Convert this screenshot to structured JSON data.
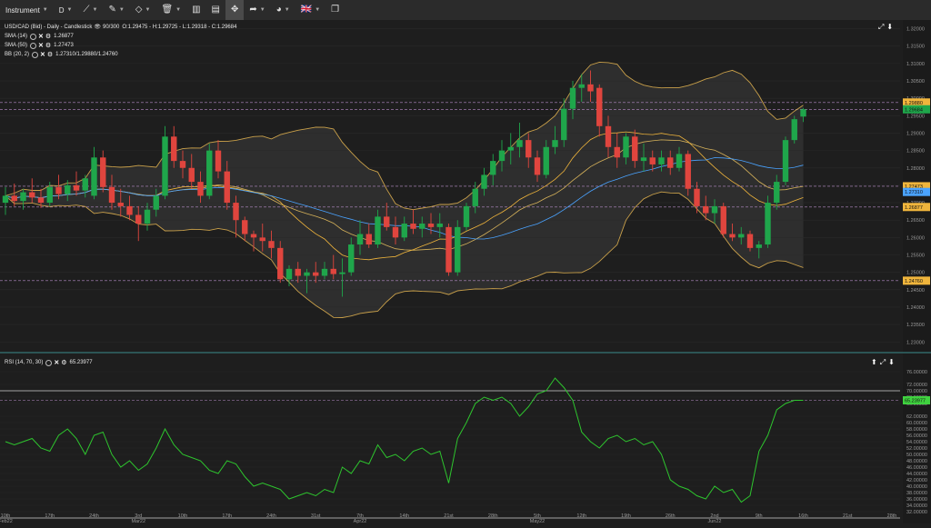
{
  "toolbar": {
    "instrument_label": "Instrument",
    "timeframe_label": "D",
    "flag_label": "🇬🇧"
  },
  "price_panel": {
    "info_line": "USD/CAD (Bid) - Daily - Candlestick",
    "bars_info": "90/300",
    "ohlc": "O:1.29475 - H:1.29725 - L:1.29318 - C:1.29684",
    "sma14_label": "SMA (14)",
    "sma14_value": "1.26877",
    "sma50_label": "SMA (50)",
    "sma50_value": "1.27473",
    "bb_label": "BB (20, 2)",
    "bb_value": "1.27310/1.29880/1.24760",
    "y_ticks": [
      "1.32000",
      "1.31500",
      "1.31000",
      "1.30500",
      "1.30000",
      "1.29500",
      "1.29000",
      "1.28500",
      "1.28000",
      "1.27500",
      "1.27000",
      "1.26500",
      "1.26000",
      "1.25500",
      "1.25000",
      "1.24500",
      "1.24000",
      "1.23500",
      "1.23000"
    ],
    "price_tags": [
      {
        "label": "1.29880",
        "color": "#f0b53c",
        "value": 1.2988
      },
      {
        "label": "1.29684",
        "color": "#1fa64b",
        "value": 1.29684
      },
      {
        "label": "1.27473",
        "color": "#f0b53c",
        "value": 1.27473
      },
      {
        "label": "1.27310",
        "color": "#4aa3ff",
        "value": 1.2731
      },
      {
        "label": "1.26877",
        "color": "#f0b53c",
        "value": 1.26877
      },
      {
        "label": "1.24760",
        "color": "#f0b53c",
        "value": 1.2476
      }
    ]
  },
  "rsi_panel": {
    "label": "RSI (14, 70, 30)",
    "value": "65.23977",
    "y_ticks": [
      "76.00000",
      "72.00000",
      "70.00000",
      "68.00000",
      "66.00000",
      "62.00000",
      "60.00000",
      "58.00000",
      "56.00000",
      "54.00000",
      "52.00000",
      "50.00000",
      "48.00000",
      "46.00000",
      "44.00000",
      "42.00000",
      "40.00000",
      "38.00000",
      "36.00000",
      "34.00000",
      "32.00000"
    ],
    "tag": {
      "label": "65.23977",
      "color": "#3fd23f"
    }
  },
  "x_axis": {
    "labels": [
      {
        "text": "10th",
        "sub": "Feb22",
        "i": 0
      },
      {
        "text": "17th",
        "sub": "",
        "i": 5
      },
      {
        "text": "24th",
        "sub": "",
        "i": 10
      },
      {
        "text": "3rd",
        "sub": "Mar22",
        "i": 15
      },
      {
        "text": "10th",
        "sub": "",
        "i": 20
      },
      {
        "text": "17th",
        "sub": "",
        "i": 25
      },
      {
        "text": "24th",
        "sub": "",
        "i": 30
      },
      {
        "text": "31st",
        "sub": "",
        "i": 35
      },
      {
        "text": "7th",
        "sub": "Apr22",
        "i": 40
      },
      {
        "text": "14th",
        "sub": "",
        "i": 45
      },
      {
        "text": "21st",
        "sub": "",
        "i": 50
      },
      {
        "text": "28th",
        "sub": "",
        "i": 55
      },
      {
        "text": "5th",
        "sub": "May22",
        "i": 60
      },
      {
        "text": "12th",
        "sub": "",
        "i": 65
      },
      {
        "text": "19th",
        "sub": "",
        "i": 70
      },
      {
        "text": "26th",
        "sub": "",
        "i": 75
      },
      {
        "text": "2nd",
        "sub": "Jun22",
        "i": 80
      },
      {
        "text": "9th",
        "sub": "",
        "i": 85
      },
      {
        "text": "16th",
        "sub": "",
        "i": 90
      },
      {
        "text": "21st",
        "sub": "",
        "i": 95
      },
      {
        "text": "28th",
        "sub": "",
        "i": 100
      }
    ]
  },
  "chart_data": [
    {
      "type": "candlestick",
      "title": "USD/CAD (Bid) - Daily - Candlestick",
      "ylim": [
        1.2285,
        1.3225
      ],
      "bb_upper_value": 1.2988,
      "bb_lower_value": 1.2476,
      "sma50_value": 1.27473,
      "close_value": 1.29684,
      "candles": [
        {
          "o": 1.27,
          "h": 1.2745,
          "l": 1.2665,
          "c": 1.272
        },
        {
          "o": 1.272,
          "h": 1.2755,
          "l": 1.269,
          "c": 1.2705
        },
        {
          "o": 1.2705,
          "h": 1.274,
          "l": 1.268,
          "c": 1.273
        },
        {
          "o": 1.273,
          "h": 1.277,
          "l": 1.27,
          "c": 1.2715
        },
        {
          "o": 1.2715,
          "h": 1.274,
          "l": 1.2685,
          "c": 1.27
        },
        {
          "o": 1.27,
          "h": 1.276,
          "l": 1.269,
          "c": 1.2745
        },
        {
          "o": 1.2745,
          "h": 1.278,
          "l": 1.271,
          "c": 1.2725
        },
        {
          "o": 1.2725,
          "h": 1.2765,
          "l": 1.2705,
          "c": 1.275
        },
        {
          "o": 1.275,
          "h": 1.279,
          "l": 1.272,
          "c": 1.2735
        },
        {
          "o": 1.2735,
          "h": 1.278,
          "l": 1.2715,
          "c": 1.277
        },
        {
          "o": 1.272,
          "h": 1.286,
          "l": 1.271,
          "c": 1.283
        },
        {
          "o": 1.283,
          "h": 1.285,
          "l": 1.273,
          "c": 1.2745
        },
        {
          "o": 1.2745,
          "h": 1.278,
          "l": 1.268,
          "c": 1.27
        },
        {
          "o": 1.27,
          "h": 1.274,
          "l": 1.266,
          "c": 1.269
        },
        {
          "o": 1.269,
          "h": 1.272,
          "l": 1.265,
          "c": 1.2665
        },
        {
          "o": 1.2665,
          "h": 1.269,
          "l": 1.259,
          "c": 1.264
        },
        {
          "o": 1.264,
          "h": 1.27,
          "l": 1.262,
          "c": 1.268
        },
        {
          "o": 1.268,
          "h": 1.274,
          "l": 1.266,
          "c": 1.272
        },
        {
          "o": 1.272,
          "h": 1.292,
          "l": 1.271,
          "c": 1.289
        },
        {
          "o": 1.289,
          "h": 1.292,
          "l": 1.28,
          "c": 1.282
        },
        {
          "o": 1.282,
          "h": 1.285,
          "l": 1.277,
          "c": 1.28
        },
        {
          "o": 1.28,
          "h": 1.284,
          "l": 1.274,
          "c": 1.276
        },
        {
          "o": 1.276,
          "h": 1.279,
          "l": 1.27,
          "c": 1.272
        },
        {
          "o": 1.272,
          "h": 1.287,
          "l": 1.271,
          "c": 1.285
        },
        {
          "o": 1.285,
          "h": 1.288,
          "l": 1.277,
          "c": 1.279
        },
        {
          "o": 1.279,
          "h": 1.282,
          "l": 1.268,
          "c": 1.27
        },
        {
          "o": 1.27,
          "h": 1.272,
          "l": 1.26,
          "c": 1.265
        },
        {
          "o": 1.265,
          "h": 1.266,
          "l": 1.259,
          "c": 1.261
        },
        {
          "o": 1.261,
          "h": 1.262,
          "l": 1.256,
          "c": 1.26
        },
        {
          "o": 1.26,
          "h": 1.264,
          "l": 1.256,
          "c": 1.259
        },
        {
          "o": 1.259,
          "h": 1.262,
          "l": 1.254,
          "c": 1.257
        },
        {
          "o": 1.257,
          "h": 1.259,
          "l": 1.247,
          "c": 1.248
        },
        {
          "o": 1.248,
          "h": 1.252,
          "l": 1.246,
          "c": 1.251
        },
        {
          "o": 1.251,
          "h": 1.253,
          "l": 1.247,
          "c": 1.249
        },
        {
          "o": 1.249,
          "h": 1.251,
          "l": 1.244,
          "c": 1.25
        },
        {
          "o": 1.25,
          "h": 1.253,
          "l": 1.247,
          "c": 1.249
        },
        {
          "o": 1.249,
          "h": 1.253,
          "l": 1.248,
          "c": 1.251
        },
        {
          "o": 1.251,
          "h": 1.255,
          "l": 1.248,
          "c": 1.2495
        },
        {
          "o": 1.2495,
          "h": 1.254,
          "l": 1.243,
          "c": 1.25
        },
        {
          "o": 1.25,
          "h": 1.26,
          "l": 1.249,
          "c": 1.258
        },
        {
          "o": 1.258,
          "h": 1.265,
          "l": 1.255,
          "c": 1.261
        },
        {
          "o": 1.261,
          "h": 1.264,
          "l": 1.257,
          "c": 1.258
        },
        {
          "o": 1.258,
          "h": 1.268,
          "l": 1.257,
          "c": 1.266
        },
        {
          "o": 1.266,
          "h": 1.27,
          "l": 1.262,
          "c": 1.263
        },
        {
          "o": 1.263,
          "h": 1.266,
          "l": 1.258,
          "c": 1.26
        },
        {
          "o": 1.26,
          "h": 1.266,
          "l": 1.259,
          "c": 1.264
        },
        {
          "o": 1.264,
          "h": 1.268,
          "l": 1.261,
          "c": 1.2625
        },
        {
          "o": 1.2625,
          "h": 1.266,
          "l": 1.26,
          "c": 1.264
        },
        {
          "o": 1.264,
          "h": 1.267,
          "l": 1.261,
          "c": 1.263
        },
        {
          "o": 1.263,
          "h": 1.267,
          "l": 1.26,
          "c": 1.264
        },
        {
          "o": 1.263,
          "h": 1.264,
          "l": 1.249,
          "c": 1.25
        },
        {
          "o": 1.25,
          "h": 1.265,
          "l": 1.249,
          "c": 1.263
        },
        {
          "o": 1.263,
          "h": 1.27,
          "l": 1.262,
          "c": 1.269
        },
        {
          "o": 1.269,
          "h": 1.276,
          "l": 1.267,
          "c": 1.274
        },
        {
          "o": 1.274,
          "h": 1.28,
          "l": 1.272,
          "c": 1.278
        },
        {
          "o": 1.278,
          "h": 1.284,
          "l": 1.275,
          "c": 1.282
        },
        {
          "o": 1.282,
          "h": 1.288,
          "l": 1.279,
          "c": 1.285
        },
        {
          "o": 1.285,
          "h": 1.29,
          "l": 1.281,
          "c": 1.286
        },
        {
          "o": 1.286,
          "h": 1.293,
          "l": 1.283,
          "c": 1.288
        },
        {
          "o": 1.288,
          "h": 1.29,
          "l": 1.28,
          "c": 1.283
        },
        {
          "o": 1.283,
          "h": 1.285,
          "l": 1.276,
          "c": 1.278
        },
        {
          "o": 1.278,
          "h": 1.288,
          "l": 1.277,
          "c": 1.286
        },
        {
          "o": 1.286,
          "h": 1.292,
          "l": 1.284,
          "c": 1.288
        },
        {
          "o": 1.288,
          "h": 1.3,
          "l": 1.286,
          "c": 1.297
        },
        {
          "o": 1.297,
          "h": 1.305,
          "l": 1.294,
          "c": 1.303
        },
        {
          "o": 1.303,
          "h": 1.307,
          "l": 1.299,
          "c": 1.304
        },
        {
          "o": 1.304,
          "h": 1.308,
          "l": 1.299,
          "c": 1.302
        },
        {
          "o": 1.303,
          "h": 1.304,
          "l": 1.289,
          "c": 1.292
        },
        {
          "o": 1.292,
          "h": 1.295,
          "l": 1.283,
          "c": 1.286
        },
        {
          "o": 1.286,
          "h": 1.29,
          "l": 1.28,
          "c": 1.283
        },
        {
          "o": 1.283,
          "h": 1.29,
          "l": 1.281,
          "c": 1.289
        },
        {
          "o": 1.289,
          "h": 1.291,
          "l": 1.28,
          "c": 1.282
        },
        {
          "o": 1.282,
          "h": 1.287,
          "l": 1.279,
          "c": 1.283
        },
        {
          "o": 1.283,
          "h": 1.285,
          "l": 1.279,
          "c": 1.281
        },
        {
          "o": 1.281,
          "h": 1.285,
          "l": 1.279,
          "c": 1.283
        },
        {
          "o": 1.283,
          "h": 1.285,
          "l": 1.278,
          "c": 1.28
        },
        {
          "o": 1.28,
          "h": 1.286,
          "l": 1.279,
          "c": 1.284
        },
        {
          "o": 1.284,
          "h": 1.285,
          "l": 1.272,
          "c": 1.274
        },
        {
          "o": 1.274,
          "h": 1.276,
          "l": 1.267,
          "c": 1.269
        },
        {
          "o": 1.269,
          "h": 1.272,
          "l": 1.265,
          "c": 1.267
        },
        {
          "o": 1.267,
          "h": 1.271,
          "l": 1.264,
          "c": 1.269
        },
        {
          "o": 1.269,
          "h": 1.27,
          "l": 1.26,
          "c": 1.261
        },
        {
          "o": 1.261,
          "h": 1.264,
          "l": 1.259,
          "c": 1.26
        },
        {
          "o": 1.26,
          "h": 1.263,
          "l": 1.258,
          "c": 1.261
        },
        {
          "o": 1.261,
          "h": 1.262,
          "l": 1.256,
          "c": 1.257
        },
        {
          "o": 1.257,
          "h": 1.259,
          "l": 1.254,
          "c": 1.258
        },
        {
          "o": 1.258,
          "h": 1.272,
          "l": 1.257,
          "c": 1.27
        },
        {
          "o": 1.27,
          "h": 1.278,
          "l": 1.268,
          "c": 1.276
        },
        {
          "o": 1.276,
          "h": 1.289,
          "l": 1.275,
          "c": 1.288
        },
        {
          "o": 1.288,
          "h": 1.295,
          "l": 1.287,
          "c": 1.294
        },
        {
          "o": 1.29475,
          "h": 1.29725,
          "l": 1.29318,
          "c": 1.29684
        }
      ]
    },
    {
      "type": "line",
      "title": "RSI (14, 70, 30)",
      "ylim": [
        30,
        78
      ],
      "overbought": 70,
      "oversold": 30,
      "values": [
        54,
        53,
        54,
        55,
        52,
        51,
        56,
        58,
        55,
        50,
        56,
        57,
        50,
        46,
        48,
        45,
        47,
        52,
        58,
        53,
        50,
        49,
        48,
        45,
        44,
        48,
        47,
        43,
        40,
        41,
        40,
        39,
        36,
        37,
        38,
        37,
        39,
        38,
        46,
        44,
        48,
        47,
        53,
        49,
        50,
        48,
        51,
        52,
        50,
        51,
        41,
        55,
        60,
        66,
        68,
        67,
        68,
        66,
        62,
        65,
        69,
        70,
        74,
        71,
        67,
        57,
        54,
        52,
        55,
        56,
        54,
        55,
        53,
        54,
        50,
        42,
        40,
        39,
        37,
        36,
        40,
        38,
        39,
        35,
        37,
        51,
        56,
        64,
        66,
        67,
        67
      ]
    }
  ]
}
